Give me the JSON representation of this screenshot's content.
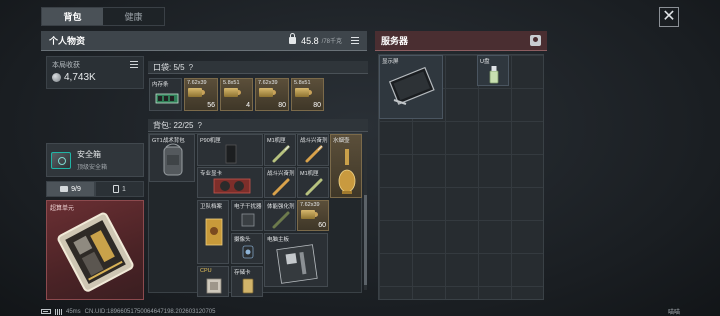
{
  "top_tabs": [
    {
      "label": "背包",
      "active": true
    },
    {
      "label": "健康",
      "active": false
    }
  ],
  "close_icon": "close-icon",
  "left_panel": {
    "title": "个人物资",
    "weight_value": "45.8",
    "weight_max": "/78千克"
  },
  "right_panel": {
    "title": "服务器"
  },
  "income": {
    "label": "本局收获",
    "value": "4,743K"
  },
  "safe": {
    "title": "安全箱",
    "subtitle": "顶级安全箱"
  },
  "sub_tabs": [
    {
      "label": "9/9",
      "icon": "bag-icon"
    },
    {
      "label": "1",
      "icon": "card-icon"
    }
  ],
  "equipped_card": {
    "label": "超算单元"
  },
  "pocket": {
    "title": "口袋: 5/5"
  },
  "pocket_items": [
    {
      "name": "内存条",
      "count": ""
    },
    {
      "name": "7.62x39",
      "count": "56"
    },
    {
      "name": "5.8x51",
      "count": "4"
    },
    {
      "name": "7.62x39",
      "count": "80"
    },
    {
      "name": "5.8x51",
      "count": "80"
    }
  ],
  "backpack": {
    "title": "背包: 22/25"
  },
  "backpack_items": {
    "pack": "GT1战术背包",
    "p90": "P90机匣",
    "m1": "M1机匣",
    "fire1": "战斗兴奋剂",
    "bottle": "水烟壶",
    "card": "专业显卡",
    "fire2": "战斗兴奋剂",
    "m1b": "M1机匣",
    "book": "卫队档案",
    "circuit": "电子干扰器",
    "tool": "体能强化剂",
    "ammo3": "7.62x39",
    "ammo3_count": "60",
    "camera": "摄像头",
    "board": "电脑主板",
    "cpu": "CPU",
    "memcard": "存储卡"
  },
  "server_items": [
    {
      "name": "显示屏"
    },
    {
      "name": "U盘"
    }
  ],
  "status": {
    "ping": "45ms",
    "info": "CN.UID:18966051750064647198.202603120705"
  },
  "corner": "喵喵"
}
